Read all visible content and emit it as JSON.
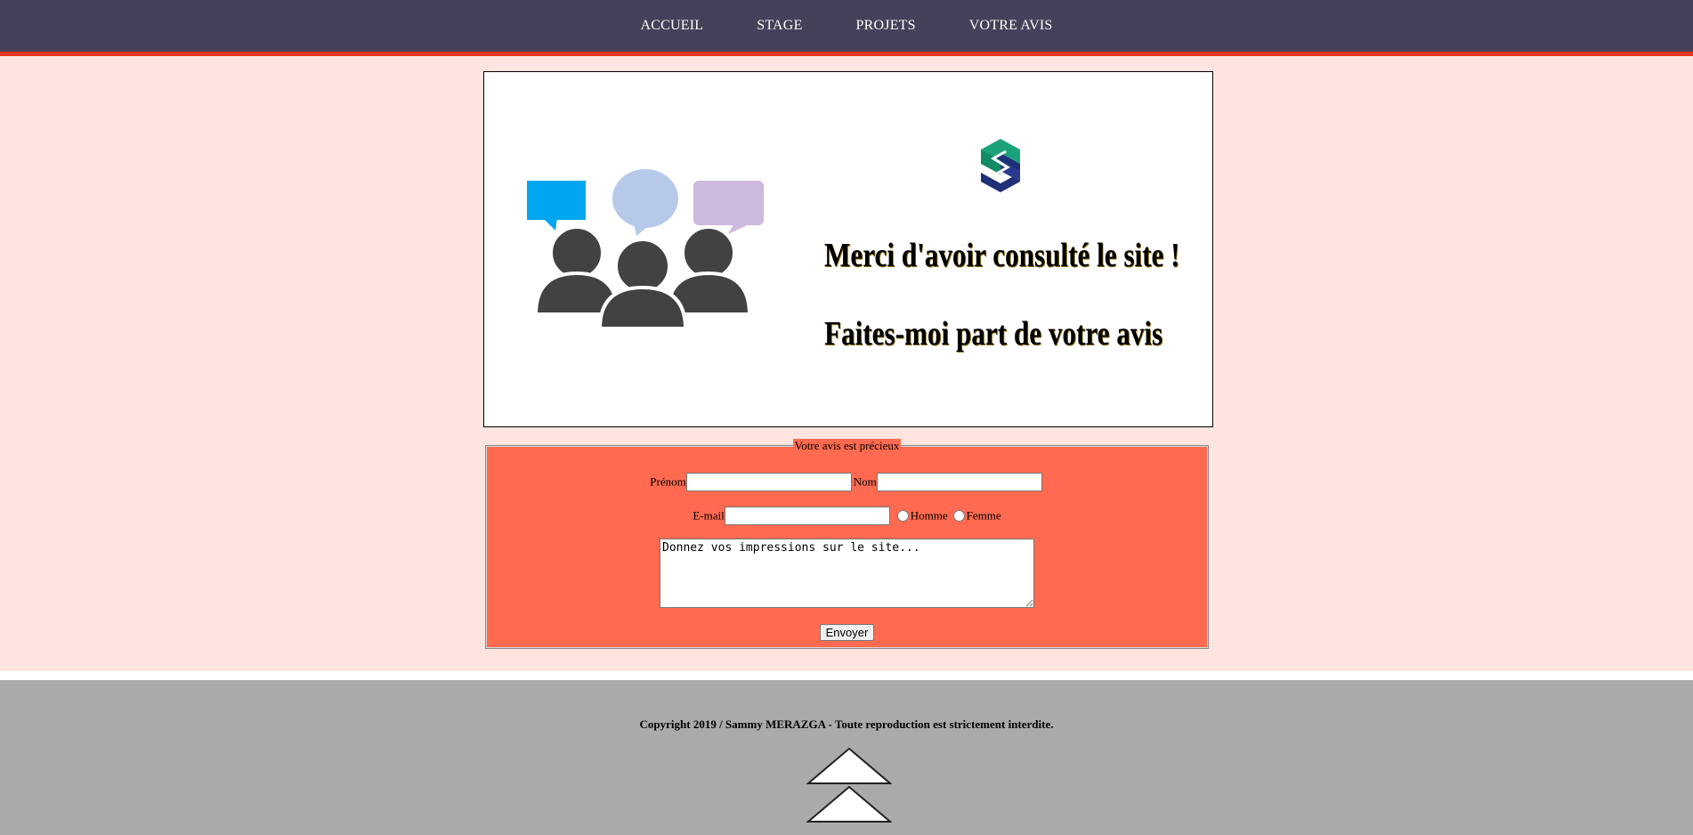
{
  "nav": {
    "items": [
      {
        "label": "ACCUEIL"
      },
      {
        "label": "STAGE"
      },
      {
        "label": "PROJETS"
      },
      {
        "label": "VOTRE AVIS"
      }
    ]
  },
  "hero": {
    "line1": "Merci d'avoir consulté le site !",
    "line2": "Faites-moi part de votre avis",
    "logo_icon": "s-logo-icon",
    "illustration_icon": "people-chat-icon"
  },
  "form": {
    "legend": "Votre avis est précieux",
    "prenom_label": "Prénom",
    "prenom_value": "",
    "nom_label": "Nom",
    "nom_value": "",
    "email_label": "E-mail",
    "email_value": "",
    "gender_options": [
      "Homme",
      "Femme"
    ],
    "comment_value": "Donnez vos impressions sur le site...",
    "submit_label": "Envoyer"
  },
  "footer": {
    "copyright": "Copyright 2019 / Sammy MERAZGA - Toute reproduction est strictement interdite.",
    "top_icon": "back-to-top-icon"
  },
  "colors": {
    "navbar": "#46415a",
    "navbar_border": "#e8341c",
    "page_background": "#ffe4df",
    "form_background": "#ff6a50",
    "footer_background": "#aaaaaa"
  }
}
